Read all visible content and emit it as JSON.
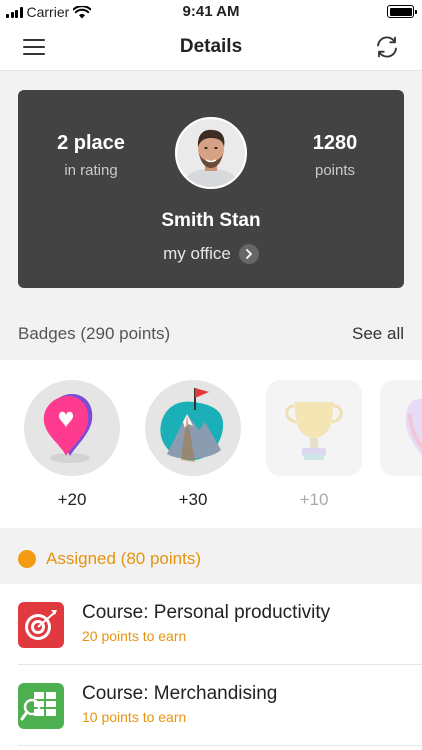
{
  "status_bar": {
    "carrier": "Carrier",
    "time": "9:41 AM"
  },
  "nav": {
    "title": "Details",
    "menu_icon": "hamburger-icon",
    "refresh_icon": "refresh-icon"
  },
  "profile": {
    "rank_value": "2 place",
    "rank_label": "in rating",
    "points_value": "1280",
    "points_label": "points",
    "name": "Smith Stan",
    "office_link": "my office"
  },
  "badges": {
    "header": "Badges (290 points)",
    "see_all": "See all",
    "items": [
      {
        "icon": "heart-pin-icon",
        "points": "+20"
      },
      {
        "icon": "mountain-flag-icon",
        "points": "+30"
      },
      {
        "icon": "trophy-icon",
        "points": "+10"
      }
    ]
  },
  "assigned": {
    "header": "Assigned (80 points)",
    "accent": "#f39c12"
  },
  "courses": [
    {
      "title": "Course: Personal productivity",
      "subtitle": "20 points to earn",
      "icon": "target-icon",
      "icon_color": "#e03a3e"
    },
    {
      "title": "Course: Merchandising",
      "subtitle": "10 points to earn",
      "icon": "shelf-icon",
      "icon_color": "#4caf50"
    }
  ]
}
